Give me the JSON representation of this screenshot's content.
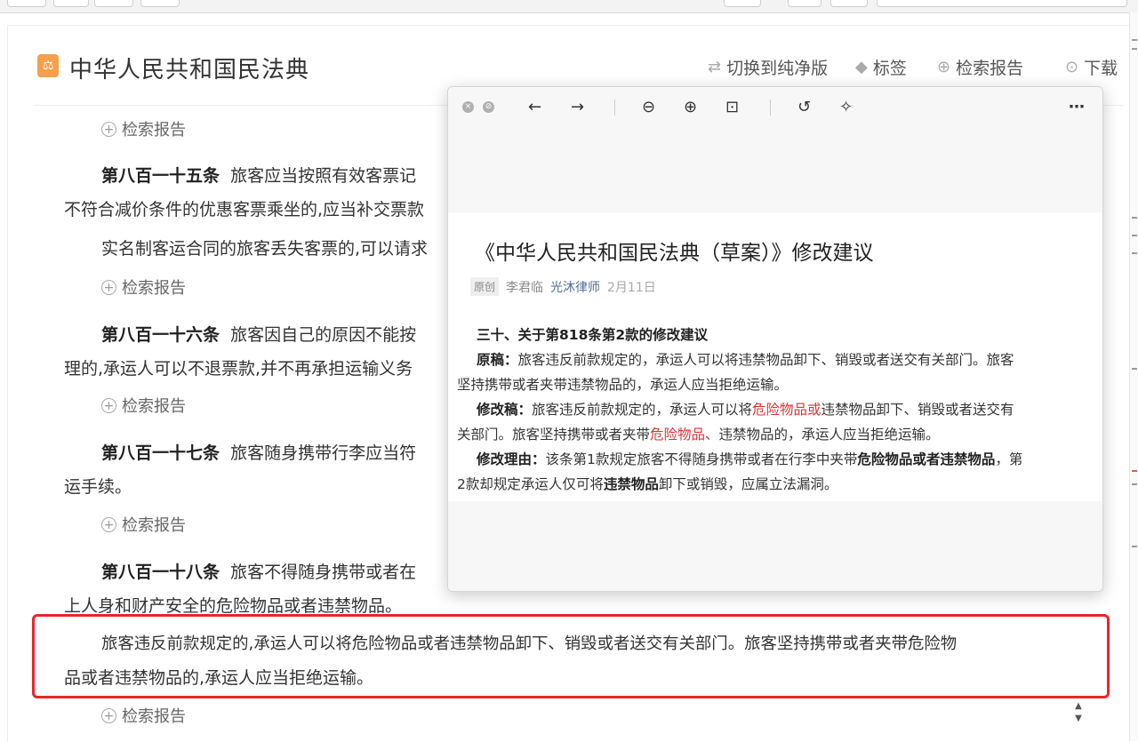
{
  "page": {
    "title": "中华人民共和国民法典",
    "title_icon": "law-book-icon",
    "toolbar": {
      "switch_label": "切换到纯净版",
      "tags_label": "标签",
      "report_label": "检索报告",
      "download_label": "下载"
    }
  },
  "content": {
    "report_link": "检索报告",
    "article_815": {
      "heading": "第八百一十五条",
      "line1": "旅客应当按照有效客票记",
      "line2": "不符合减价条件的优惠客票乘坐的,应当补交票款",
      "para2": "实名制客运合同的旅客丢失客票的,可以请求"
    },
    "article_816": {
      "heading": "第八百一十六条",
      "line1": "旅客因自己的原因不能按",
      "line2": "理的,承运人可以不退票款,并不再承担运输义务"
    },
    "article_817": {
      "heading": "第八百一十七条",
      "line1": "旅客随身携带行李应当符",
      "line2": "运手续。"
    },
    "article_818": {
      "heading": "第八百一十八条",
      "line1": "旅客不得随身携带或者在",
      "line2": "上人身和财产安全的危险物品或者违禁物品。",
      "highlight_line1": "旅客违反前款规定的,承运人可以将危险物品或者违禁物品卸下、销毁或者送交有关部门。旅客坚持携带或者夹带危险物",
      "highlight_line2": "品或者违禁物品的,承运人应当拒绝运输。"
    }
  },
  "viewer": {
    "toolbar_icons": [
      "close-icon",
      "minimize-icon",
      "back-arrow-icon",
      "forward-arrow-icon",
      "zoom-out-icon",
      "zoom-in-icon",
      "fit-page-icon",
      "rotate-icon",
      "magic-wand-icon",
      "more-icon"
    ],
    "doc": {
      "title": "《中华人民共和国民法典（草案）》修改建议",
      "tag": "原创",
      "author": "李君临",
      "account": "光沐律师",
      "date": "2月11日",
      "section_title": "三十、关于第818条第2款的修改建议",
      "orig_label": "原稿：",
      "orig_text1": "旅客违反前款规定的，承运人可以将违禁物品卸下、销毁或者送交有关部门。旅客",
      "orig_text2": "坚持携带或者夹带违禁物品的，承运人应当拒绝运输。",
      "rev_label": "修改稿：",
      "rev_text1a": "旅客违反前款规定的，承运人可以将",
      "rev_text1_red": "危险物品或",
      "rev_text1b": "违禁物品卸下、销毁或者送交有",
      "rev_text2a": "关部门。旅客坚持携带或者夹带",
      "rev_text2_red": "危险物品、",
      "rev_text2b": "违禁物品的，承运人应当拒绝运输。",
      "reason_label": "修改理由：",
      "reason_text1a": "该条第1款规定旅客不得随身携带或者在行李中夹带",
      "reason_text1_bold": "危险物品或者违禁物品",
      "reason_text1b": "，第",
      "reason_text2a": "2款却规定承运人仅可将",
      "reason_text2_bold": "违禁物品",
      "reason_text2b": "卸下或销毁，应属立法漏洞。"
    }
  },
  "colors": {
    "highlight_border": "#e8262a",
    "title_icon_bg": "#f5a04b",
    "doc_red": "#d33333",
    "account_blue": "#576b95"
  }
}
